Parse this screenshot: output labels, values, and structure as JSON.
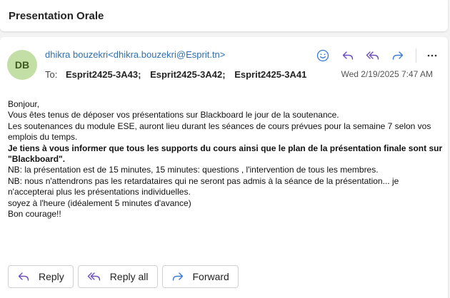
{
  "subject": "Presentation Orale",
  "message": {
    "avatar_initials": "DB",
    "sender": "dhikra bouzekri<dhikra.bouzekri@Esprit.tn>",
    "to_label": "To:",
    "recipients": [
      "Esprit2425-3A43;",
      "Esprit2425-3A42;",
      "Esprit2425-3A41"
    ],
    "date": "Wed 2/19/2025 7:47 AM",
    "toolbar_icons": [
      "emoji-react-icon",
      "reply-icon",
      "reply-all-icon",
      "forward-icon",
      "more-icon"
    ],
    "body_lines": [
      "Bonjour,",
      "Vous êtes tenus de déposer vos présentations sur Blackboard le jour de la soutenance.",
      "Les soutenances du module ESE, auront lieu durant les séances de cours prévues pour la semaine 7 selon vos emplois du temps.",
      "Je tiens à vous informer que  tous les supports du cours ainsi que le plan de la présentation finale sont sur \"Blackboard\".",
      "NB: la présentation est de 15 minutes,  15 minutes: questions , l'intervention de tous les membres.",
      "NB:    nous n'attendrons pas les retardataires qui ne seront pas admis à la séance de la présentation... je n'accepterai plus les présentations individuelles.",
      "soyez à l'heure (idéalement 5 minutes d'avance)",
      "Bon courage!!"
    ]
  },
  "actions": {
    "reply": "Reply",
    "reply_all": "Reply all",
    "forward": "Forward"
  },
  "colors": {
    "accent": "#2f6fb0",
    "icon_purple": "#6b4fbb",
    "icon_blue": "#3a7bd5",
    "avatar_bg": "#c4dfa6"
  }
}
